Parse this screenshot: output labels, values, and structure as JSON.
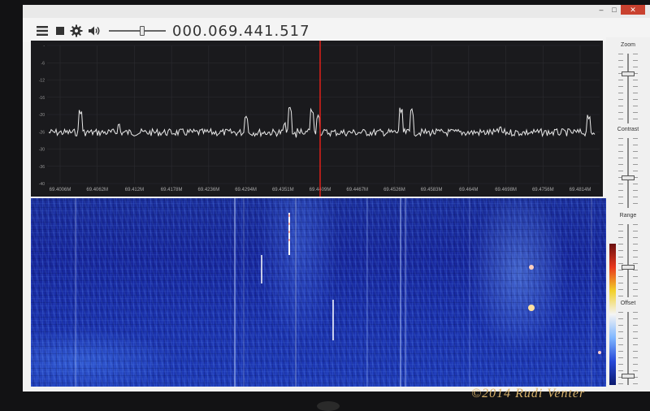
{
  "toolbar": {
    "icons": [
      "menu-icon",
      "stop-icon",
      "gear-icon",
      "volume-icon"
    ],
    "volume_level": 0.6,
    "frequency": "000.069.441.517"
  },
  "window": {
    "min_glyph": "–",
    "max_glyph": "□",
    "close_glyph": "✕"
  },
  "spectrum": {
    "y_ticks": [
      "-",
      "-6",
      "-12",
      "-16",
      "-20",
      "-26",
      "-30",
      "-36",
      "-40"
    ],
    "x_ticks": [
      "69.4006M",
      "69.4062M",
      "69.412M",
      "69.4178M",
      "69.4236M",
      "69.4294M",
      "69.4351M",
      "69.4409M",
      "69.4467M",
      "69.4526M",
      "69.4583M",
      "69.464M",
      "69.4698M",
      "69.4756M",
      "69.4814M"
    ],
    "center_marker": "69.4409M",
    "trace_color": "#e8e8e8",
    "marker_color": "#e0201a"
  },
  "side_controls": {
    "zoom": {
      "label": "Zoom",
      "level": 0.28
    },
    "contrast": {
      "label": "Contrast",
      "level": 0.58
    },
    "range": {
      "label": "Range",
      "level": 0.6
    },
    "offset": {
      "label": "Offset",
      "level": 0.9
    }
  },
  "watermark": "©2014 Rudi Venter"
}
